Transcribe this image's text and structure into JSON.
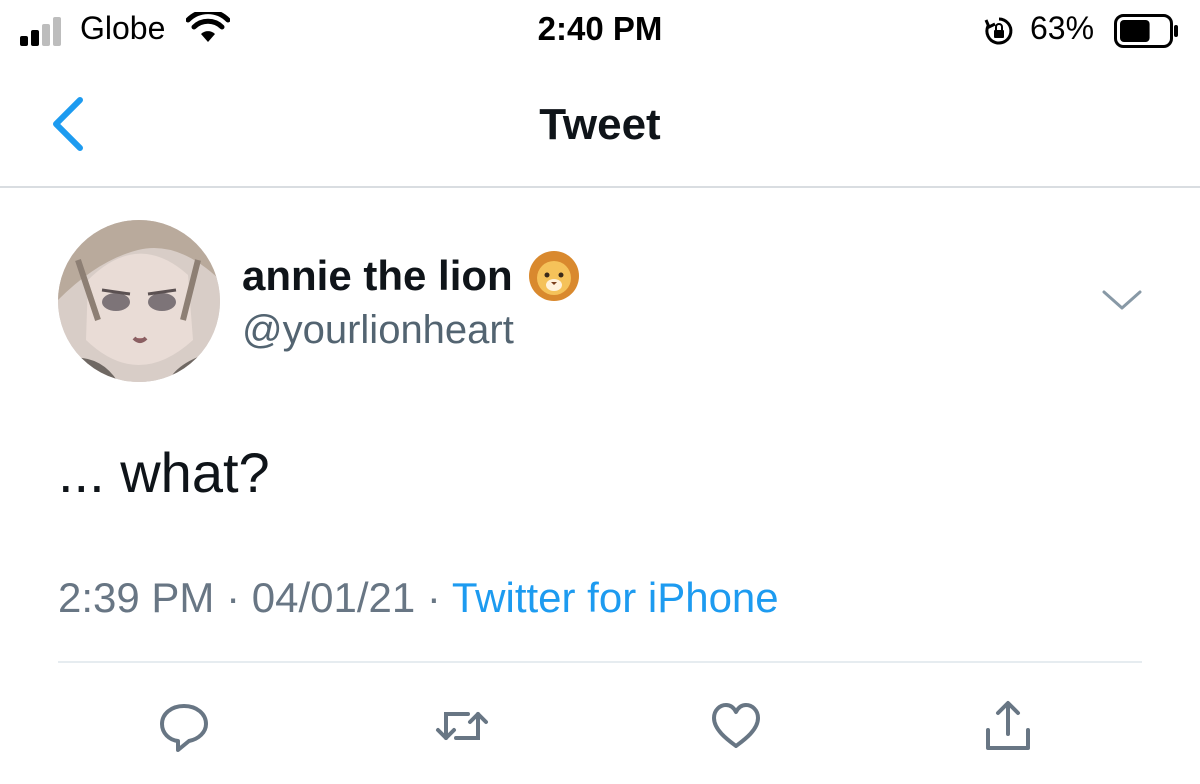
{
  "status_bar": {
    "carrier": "Globe",
    "time": "2:40 PM",
    "battery_percent": "63%",
    "battery_level": 0.63,
    "icons": [
      "signal-icon",
      "wifi-icon",
      "rotation-lock-icon",
      "battery-icon"
    ]
  },
  "nav": {
    "back_icon": "chevron-left-icon",
    "title": "Tweet"
  },
  "tweet": {
    "display_name": "annie the lion",
    "name_emoji_icon": "lion-face-icon",
    "handle": "@yourlionheart",
    "text": "... what?",
    "time": "2:39 PM",
    "separator": " · ",
    "date": "04/01/21",
    "source": "Twitter for iPhone",
    "more_icon": "chevron-down-icon"
  },
  "actions": [
    {
      "icon": "reply-icon"
    },
    {
      "icon": "retweet-icon"
    },
    {
      "icon": "like-icon"
    },
    {
      "icon": "share-icon"
    }
  ],
  "colors": {
    "accent": "#1d9bf0",
    "text_primary": "#0f1419",
    "text_secondary": "#536471",
    "divider": "#e6ecf0"
  }
}
